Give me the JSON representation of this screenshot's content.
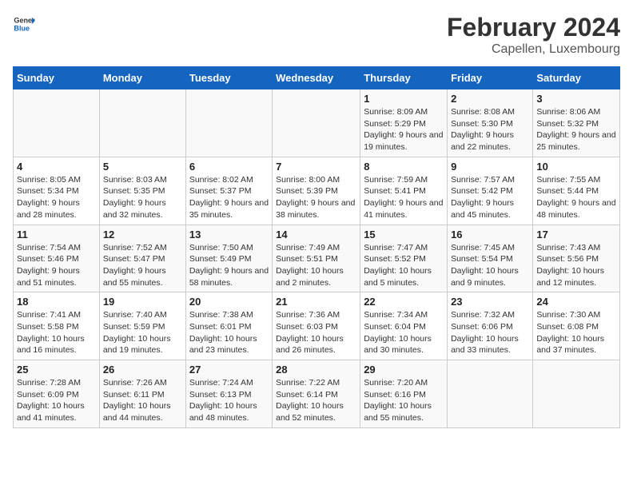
{
  "header": {
    "logo_general": "General",
    "logo_blue": "Blue",
    "main_title": "February 2024",
    "subtitle": "Capellen, Luxembourg"
  },
  "weekdays": [
    "Sunday",
    "Monday",
    "Tuesday",
    "Wednesday",
    "Thursday",
    "Friday",
    "Saturday"
  ],
  "weeks": [
    [
      {
        "day": "",
        "info": ""
      },
      {
        "day": "",
        "info": ""
      },
      {
        "day": "",
        "info": ""
      },
      {
        "day": "",
        "info": ""
      },
      {
        "day": "1",
        "info": "Sunrise: 8:09 AM\nSunset: 5:29 PM\nDaylight: 9 hours\nand 19 minutes."
      },
      {
        "day": "2",
        "info": "Sunrise: 8:08 AM\nSunset: 5:30 PM\nDaylight: 9 hours\nand 22 minutes."
      },
      {
        "day": "3",
        "info": "Sunrise: 8:06 AM\nSunset: 5:32 PM\nDaylight: 9 hours\nand 25 minutes."
      }
    ],
    [
      {
        "day": "4",
        "info": "Sunrise: 8:05 AM\nSunset: 5:34 PM\nDaylight: 9 hours\nand 28 minutes."
      },
      {
        "day": "5",
        "info": "Sunrise: 8:03 AM\nSunset: 5:35 PM\nDaylight: 9 hours\nand 32 minutes."
      },
      {
        "day": "6",
        "info": "Sunrise: 8:02 AM\nSunset: 5:37 PM\nDaylight: 9 hours\nand 35 minutes."
      },
      {
        "day": "7",
        "info": "Sunrise: 8:00 AM\nSunset: 5:39 PM\nDaylight: 9 hours\nand 38 minutes."
      },
      {
        "day": "8",
        "info": "Sunrise: 7:59 AM\nSunset: 5:41 PM\nDaylight: 9 hours\nand 41 minutes."
      },
      {
        "day": "9",
        "info": "Sunrise: 7:57 AM\nSunset: 5:42 PM\nDaylight: 9 hours\nand 45 minutes."
      },
      {
        "day": "10",
        "info": "Sunrise: 7:55 AM\nSunset: 5:44 PM\nDaylight: 9 hours\nand 48 minutes."
      }
    ],
    [
      {
        "day": "11",
        "info": "Sunrise: 7:54 AM\nSunset: 5:46 PM\nDaylight: 9 hours\nand 51 minutes."
      },
      {
        "day": "12",
        "info": "Sunrise: 7:52 AM\nSunset: 5:47 PM\nDaylight: 9 hours\nand 55 minutes."
      },
      {
        "day": "13",
        "info": "Sunrise: 7:50 AM\nSunset: 5:49 PM\nDaylight: 9 hours\nand 58 minutes."
      },
      {
        "day": "14",
        "info": "Sunrise: 7:49 AM\nSunset: 5:51 PM\nDaylight: 10 hours\nand 2 minutes."
      },
      {
        "day": "15",
        "info": "Sunrise: 7:47 AM\nSunset: 5:52 PM\nDaylight: 10 hours\nand 5 minutes."
      },
      {
        "day": "16",
        "info": "Sunrise: 7:45 AM\nSunset: 5:54 PM\nDaylight: 10 hours\nand 9 minutes."
      },
      {
        "day": "17",
        "info": "Sunrise: 7:43 AM\nSunset: 5:56 PM\nDaylight: 10 hours\nand 12 minutes."
      }
    ],
    [
      {
        "day": "18",
        "info": "Sunrise: 7:41 AM\nSunset: 5:58 PM\nDaylight: 10 hours\nand 16 minutes."
      },
      {
        "day": "19",
        "info": "Sunrise: 7:40 AM\nSunset: 5:59 PM\nDaylight: 10 hours\nand 19 minutes."
      },
      {
        "day": "20",
        "info": "Sunrise: 7:38 AM\nSunset: 6:01 PM\nDaylight: 10 hours\nand 23 minutes."
      },
      {
        "day": "21",
        "info": "Sunrise: 7:36 AM\nSunset: 6:03 PM\nDaylight: 10 hours\nand 26 minutes."
      },
      {
        "day": "22",
        "info": "Sunrise: 7:34 AM\nSunset: 6:04 PM\nDaylight: 10 hours\nand 30 minutes."
      },
      {
        "day": "23",
        "info": "Sunrise: 7:32 AM\nSunset: 6:06 PM\nDaylight: 10 hours\nand 33 minutes."
      },
      {
        "day": "24",
        "info": "Sunrise: 7:30 AM\nSunset: 6:08 PM\nDaylight: 10 hours\nand 37 minutes."
      }
    ],
    [
      {
        "day": "25",
        "info": "Sunrise: 7:28 AM\nSunset: 6:09 PM\nDaylight: 10 hours\nand 41 minutes."
      },
      {
        "day": "26",
        "info": "Sunrise: 7:26 AM\nSunset: 6:11 PM\nDaylight: 10 hours\nand 44 minutes."
      },
      {
        "day": "27",
        "info": "Sunrise: 7:24 AM\nSunset: 6:13 PM\nDaylight: 10 hours\nand 48 minutes."
      },
      {
        "day": "28",
        "info": "Sunrise: 7:22 AM\nSunset: 6:14 PM\nDaylight: 10 hours\nand 52 minutes."
      },
      {
        "day": "29",
        "info": "Sunrise: 7:20 AM\nSunset: 6:16 PM\nDaylight: 10 hours\nand 55 minutes."
      },
      {
        "day": "",
        "info": ""
      },
      {
        "day": "",
        "info": ""
      }
    ]
  ]
}
